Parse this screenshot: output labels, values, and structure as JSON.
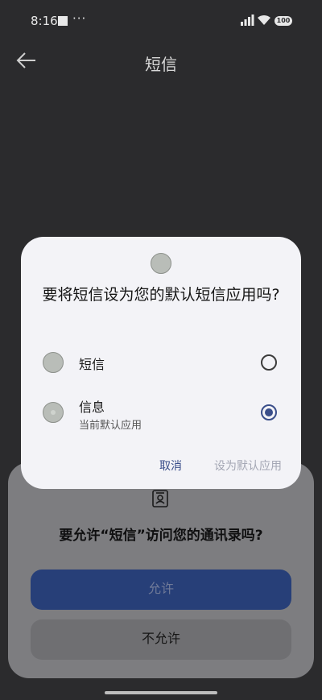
{
  "status_bar": {
    "time": "8:16",
    "dots": "···",
    "battery": "100"
  },
  "header": {
    "title": "短信",
    "back_icon": "arrow-left-icon"
  },
  "dialog": {
    "app_icon": "app-icon",
    "title": "要将短信设为您的默认短信应用吗?",
    "options": [
      {
        "label": "短信",
        "sublabel": "",
        "selected": false
      },
      {
        "label": "信息",
        "sublabel": "当前默认应用",
        "selected": true
      }
    ],
    "cancel_label": "取消",
    "confirm_label": "设为默认应用"
  },
  "permission_sheet": {
    "icon": "contacts-icon",
    "question": "要允许“短信”访问您的通讯录吗?",
    "allow_label": "允许",
    "deny_label": "不允许"
  },
  "colors": {
    "accent": "#3a4e8a",
    "scrim_background": "#2b2b2d",
    "dialog_background": "#f3f3f7"
  }
}
